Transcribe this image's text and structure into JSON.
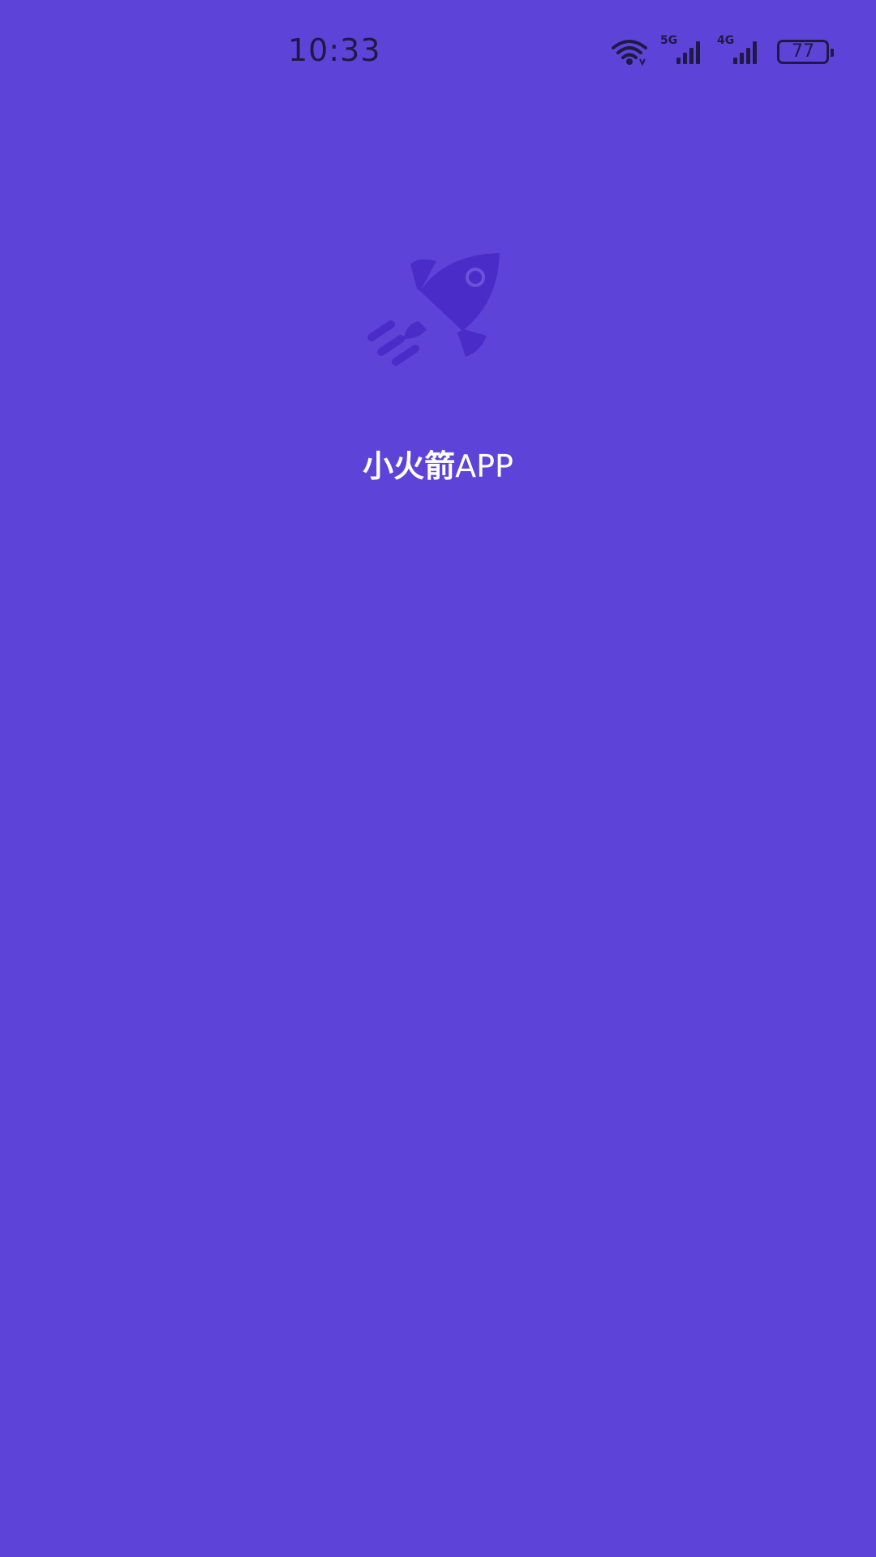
{
  "status_bar": {
    "time": "10:33",
    "network_1": "5G",
    "network_2": "4G",
    "battery_level": "77",
    "icons": [
      "wifi-icon",
      "signal-icon",
      "battery-icon"
    ]
  },
  "splash": {
    "logo_icon": "rocket-icon",
    "title_cn": "小火箭",
    "title_en": "APP"
  },
  "colors": {
    "background": "#5e43d8",
    "rocket": "#4a2dc9",
    "status_text": "#1f1a44",
    "title_text": "#ffffff"
  }
}
